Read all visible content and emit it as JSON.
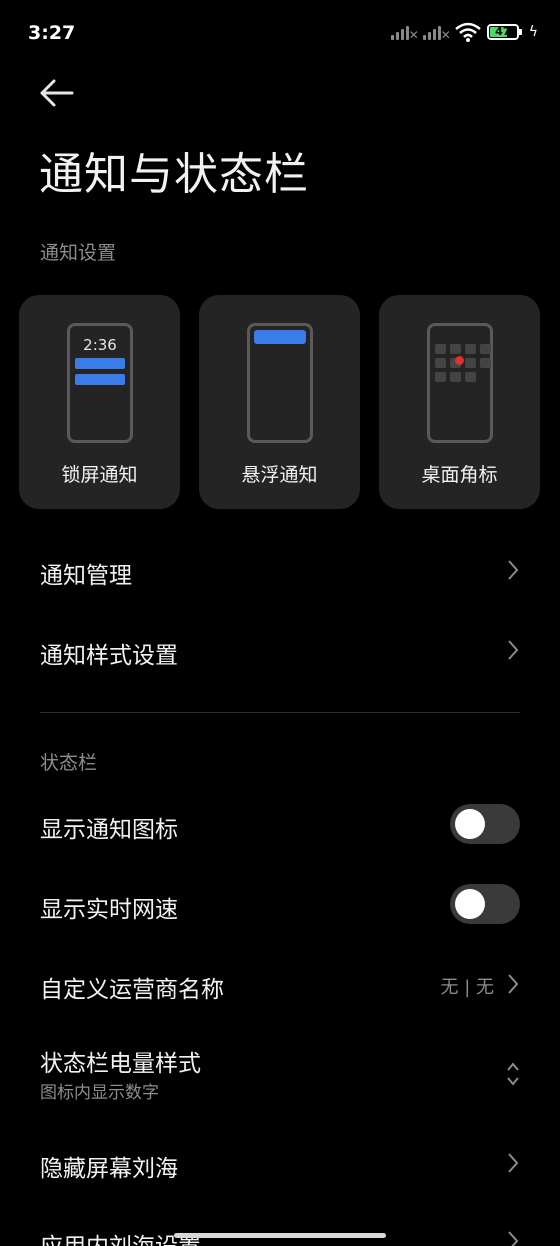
{
  "status_bar": {
    "time": "3:27",
    "battery": "47"
  },
  "page": {
    "title": "通知与状态栏"
  },
  "notification_section": {
    "label": "通知设置",
    "cards": [
      {
        "label": "锁屏通知",
        "preview_time": "2:36",
        "icon": "lockscreen-preview"
      },
      {
        "label": "悬浮通知",
        "icon": "floating-preview"
      },
      {
        "label": "桌面角标",
        "icon": "badge-preview"
      }
    ],
    "rows": [
      {
        "label": "通知管理"
      },
      {
        "label": "通知样式设置"
      }
    ]
  },
  "statusbar_section": {
    "label": "状态栏",
    "rows": [
      {
        "label": "显示通知图标",
        "toggle": false
      },
      {
        "label": "显示实时网速",
        "toggle": false
      },
      {
        "label": "自定义运营商名称",
        "value": "无 | 无"
      },
      {
        "label": "状态栏电量样式",
        "sublabel": "图标内显示数字"
      },
      {
        "label": "隐藏屏幕刘海"
      },
      {
        "label": "应用内刘海设置"
      }
    ]
  },
  "colors": {
    "background": "#000000",
    "card": "#242424",
    "accent": "#3a7ce8",
    "badge_dot": "#e03030",
    "battery_fill": "#4cd964"
  }
}
